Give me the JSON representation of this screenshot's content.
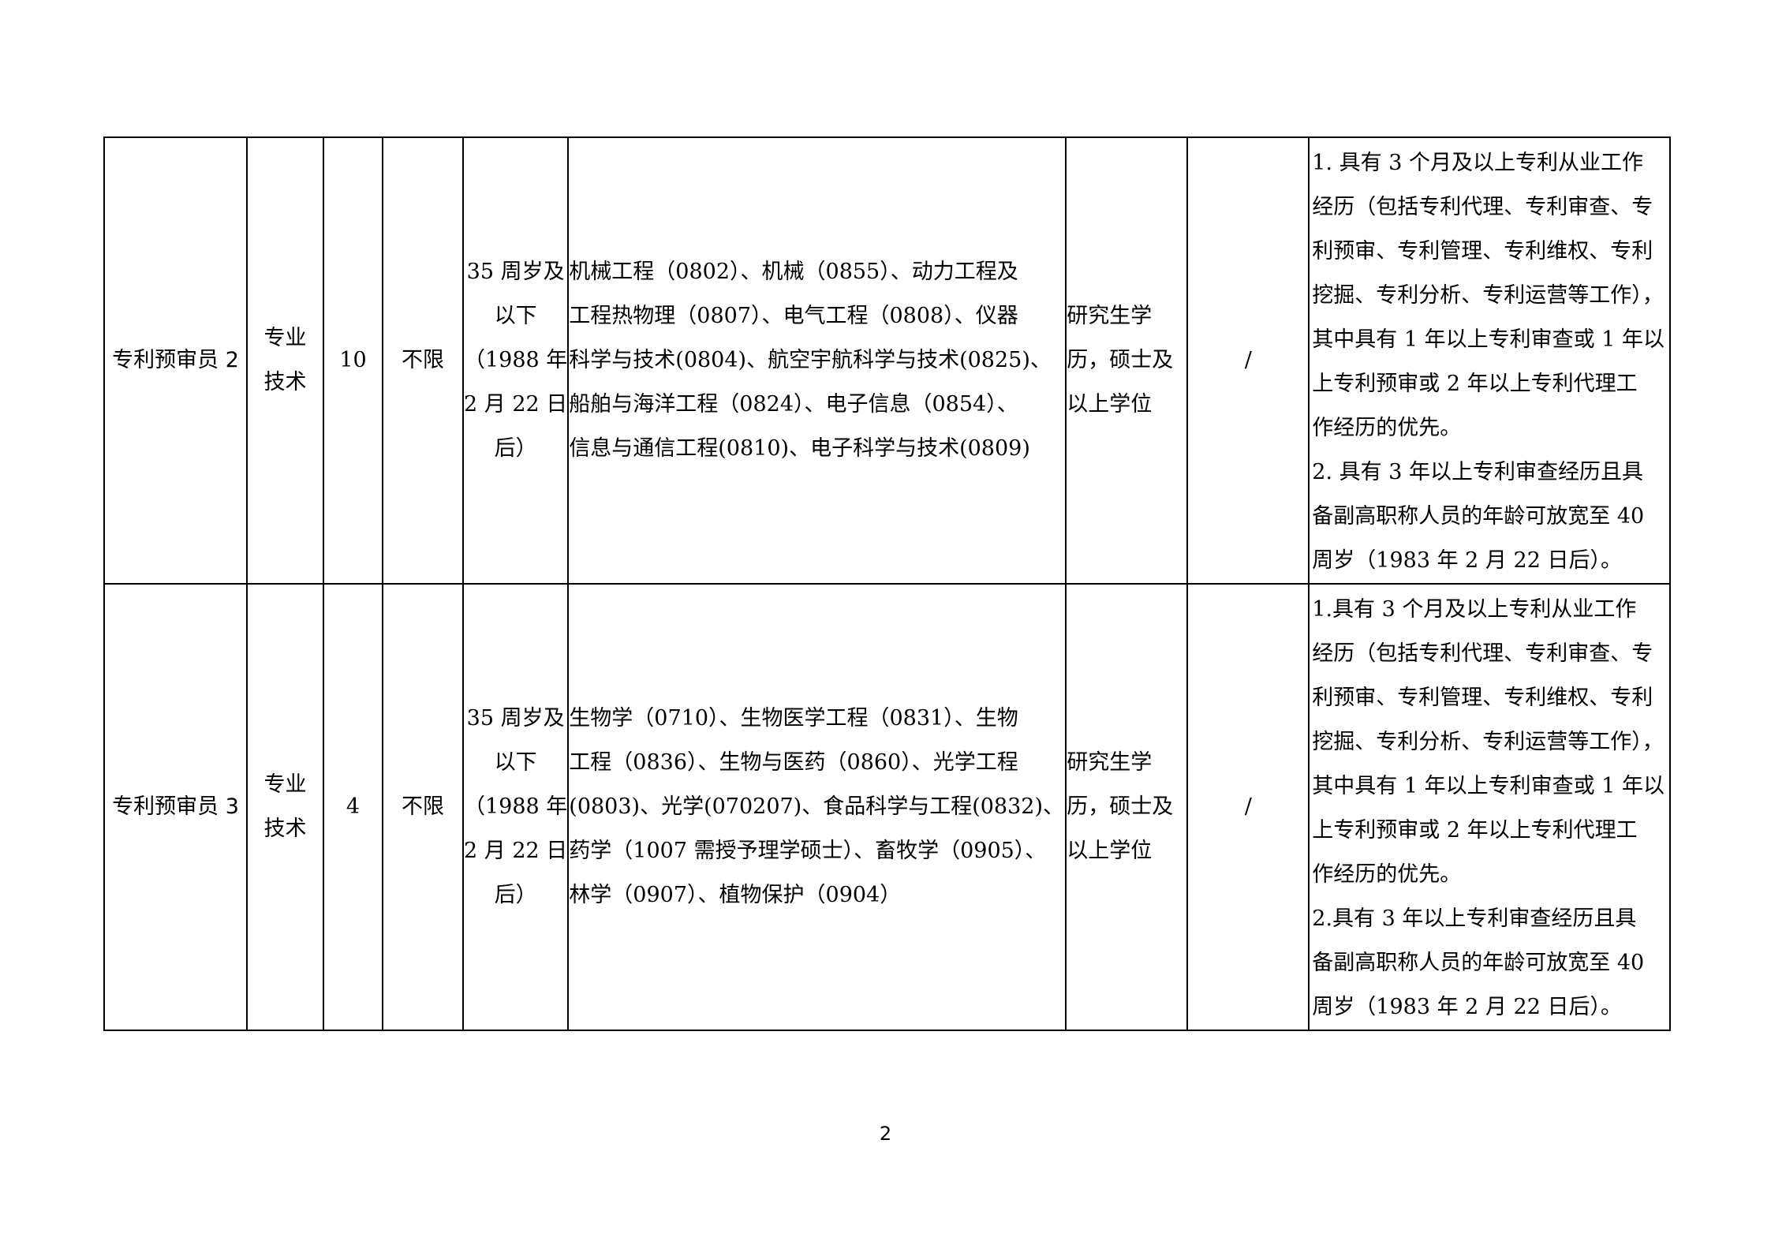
{
  "rows": [
    {
      "position": "专利预审员 2",
      "category": [
        "专业",
        "技术"
      ],
      "headcount": "10",
      "other_limit": "不限",
      "age": [
        "35 周岁及",
        "以下",
        "（1988 年",
        "2 月 22 日",
        "后）"
      ],
      "majors": [
        "机械工程（0802）、机械（0855）、动力工程及",
        "工程热物理（0807）、电气工程（0808）、仪器",
        "科学与技术(0804)、航空宇航科学与技术(0825)、",
        "船舶与海洋工程（0824）、电子信息（0854）、",
        "信息与通信工程(0810)、电子科学与技术(0809)"
      ],
      "education": [
        "研究生学",
        "历，硕士及",
        "以上学位"
      ],
      "other": "/",
      "requirements": [
        "1. 具有 3 个月及以上专利从业工作",
        "经历（包括专利代理、专利审查、专",
        "利预审、专利管理、专利维权、专利",
        "挖掘、专利分析、专利运营等工作），",
        "其中具有 1 年以上专利审查或 1 年以",
        "上专利预审或 2 年以上专利代理工",
        "作经历的优先。",
        "2. 具有 3 年以上专利审查经历且具",
        "备副高职称人员的年龄可放宽至 40",
        "周岁（1983 年 2 月 22 日后）。"
      ]
    },
    {
      "position": "专利预审员 3",
      "category": [
        "专业",
        "技术"
      ],
      "headcount": "4",
      "other_limit": "不限",
      "age": [
        "35 周岁及",
        "以下",
        "（1988 年",
        "2 月 22 日",
        "后）"
      ],
      "majors": [
        "生物学（0710）、生物医学工程（0831）、生物",
        "工程（0836）、生物与医药（0860）、光学工程",
        "(0803)、光学(070207)、食品科学与工程(0832)、",
        "药学（1007 需授予理学硕士）、畜牧学（0905）、",
        "林学（0907）、植物保护（0904）"
      ],
      "education": [
        "研究生学",
        "历，硕士及",
        "以上学位"
      ],
      "other": "/",
      "requirements": [
        "1.具有 3 个月及以上专利从业工作",
        "经历（包括专利代理、专利审查、专",
        "利预审、专利管理、专利维权、专利",
        "挖掘、专利分析、专利运营等工作），",
        "其中具有 1 年以上专利审查或 1 年以",
        "上专利预审或 2 年以上专利代理工",
        "作经历的优先。",
        "2.具有 3 年以上专利审查经历且具",
        "备副高职称人员的年龄可放宽至 40",
        "周岁（1983 年 2 月 22 日后）。"
      ]
    }
  ],
  "footer": {
    "page_number": "2"
  }
}
